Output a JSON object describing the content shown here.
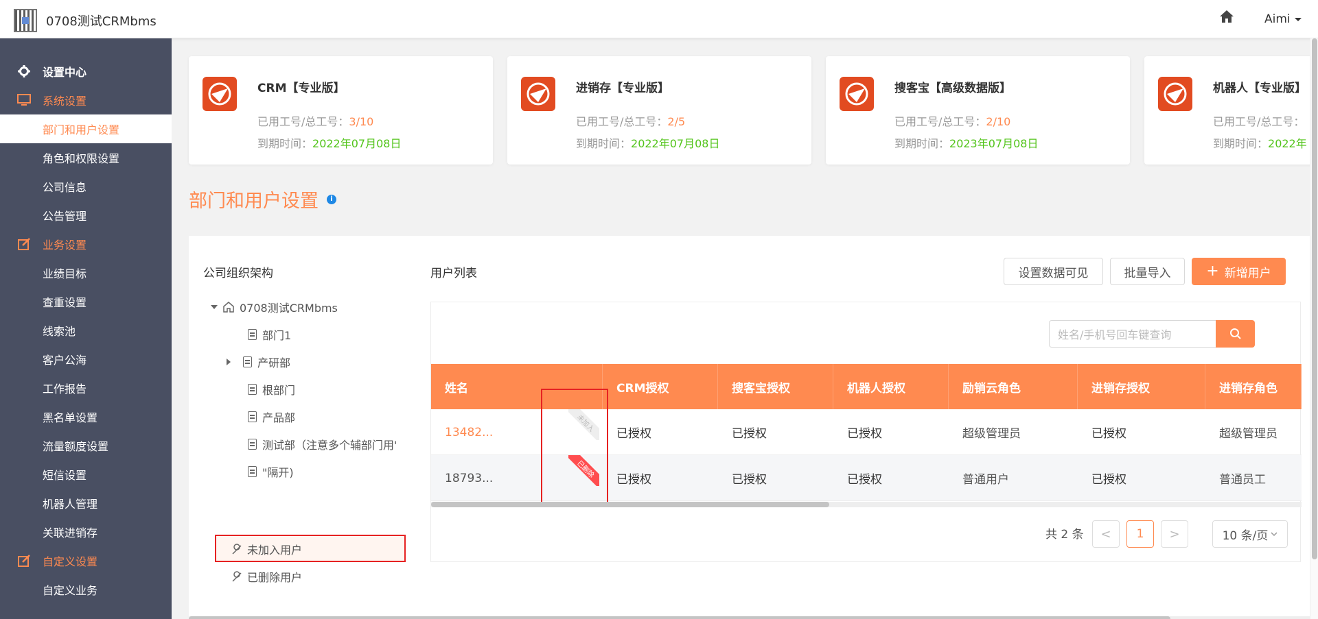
{
  "header": {
    "app_title": "0708测试CRMbms",
    "user_name": "Aimi"
  },
  "sidebar": {
    "items": [
      {
        "label": "设置中心"
      },
      {
        "label": "系统设置"
      },
      {
        "label": "部门和用户设置"
      },
      {
        "label": "角色和权限设置"
      },
      {
        "label": "公司信息"
      },
      {
        "label": "公告管理"
      },
      {
        "label": "业务设置"
      },
      {
        "label": "业绩目标"
      },
      {
        "label": "查重设置"
      },
      {
        "label": "线索池"
      },
      {
        "label": "客户公海"
      },
      {
        "label": "工作报告"
      },
      {
        "label": "黑名单设置"
      },
      {
        "label": "流量额度设置"
      },
      {
        "label": "短信设置"
      },
      {
        "label": "机器人管理"
      },
      {
        "label": "关联进销存"
      },
      {
        "label": "自定义设置"
      },
      {
        "label": "自定义业务"
      }
    ]
  },
  "products": [
    {
      "name": "CRM【专业版】",
      "seat_label": "已用工号/总工号：",
      "seat_value": "3/10",
      "expire_label": "到期时间：",
      "expire_value": "2022年07月08日"
    },
    {
      "name": "进销存【专业版】",
      "seat_label": "已用工号/总工号：",
      "seat_value": "2/5",
      "expire_label": "到期时间：",
      "expire_value": "2022年07月08日"
    },
    {
      "name": "搜客宝【高级数据版】",
      "seat_label": "已用工号/总工号：",
      "seat_value": "2/10",
      "expire_label": "到期时间：",
      "expire_value": "2023年07月08日"
    },
    {
      "name": "机器人【专业版】",
      "seat_label": "已用工号/总工号：",
      "seat_value": "",
      "expire_label": "到期时间：",
      "expire_value": "2022年"
    }
  ],
  "page_title": "部门和用户设置",
  "org": {
    "title": "公司组织架构",
    "root": "0708测试CRMbms",
    "departments": [
      "部门1",
      "产研部",
      "根部门",
      "产品部",
      "测试部（注意多个辅部门用'",
      "\"隔开)"
    ],
    "not_joined": "未加入用户",
    "deleted": "已删除用户"
  },
  "user_list": {
    "title": "用户列表",
    "btn_visibility": "设置数据可见",
    "btn_import": "批量导入",
    "btn_add": "新增用户",
    "search_placeholder": "姓名/手机号回车键查询",
    "columns": [
      "姓名",
      "CRM授权",
      "搜客宝授权",
      "机器人授权",
      "励销云角色",
      "进销存授权",
      "进销存角色"
    ],
    "rows": [
      {
        "name": "13482...",
        "tag": "未加入",
        "crm": "已授权",
        "skb": "已授权",
        "robot": "已授权",
        "lxy_role": "超级管理员",
        "jxc": "已授权",
        "jxc_role": "超级管理员"
      },
      {
        "name": "18793...",
        "tag": "已删除",
        "crm": "已授权",
        "skb": "已授权",
        "robot": "已授权",
        "lxy_role": "普通用户",
        "jxc": "已授权",
        "jxc_role": "普通员工"
      }
    ],
    "pagination": {
      "total": "共 2 条",
      "current_page": "1",
      "page_size": "10 条/页",
      "prev": "<",
      "next": ">"
    }
  },
  "colors": {
    "accent": "#ff8a50",
    "sidebar_bg": "#494f62",
    "success": "#52c41a",
    "highlight": "#e62222"
  }
}
